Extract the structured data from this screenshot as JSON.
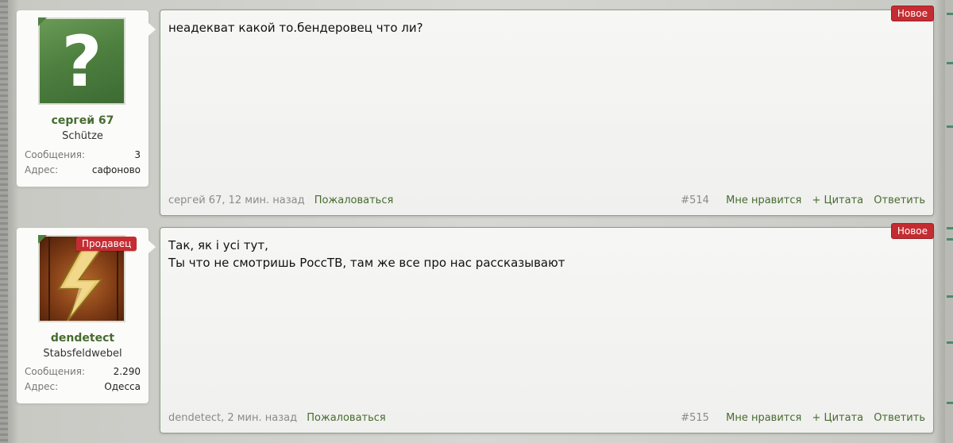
{
  "posts": [
    {
      "user": {
        "name": "сергей 67",
        "title": "Schütze",
        "posts_label": "Сообщения:",
        "posts_value": "3",
        "address_label": "Адрес:",
        "address_value": "сафоново",
        "avatar_glyph": "?"
      },
      "badge": "Новое",
      "lines": [
        "неадекват какой то.бендеровец что ли?"
      ],
      "author_time": "сергей 67, 12 мин. назад",
      "report": "Пожаловаться",
      "number": "#514",
      "like": "Мне нравится",
      "quote": "+ Цитата",
      "reply": "Ответить"
    },
    {
      "user": {
        "name": "dendetect",
        "title": "Stabsfeldwebel",
        "seller_badge": "Продавец",
        "posts_label": "Сообщения:",
        "posts_value": "2.290",
        "address_label": "Адрес:",
        "address_value": "Одесса"
      },
      "badge": "Новое",
      "lines": [
        "Так, як і усі тут,",
        "Ты что не смотришь РоссТВ, там же все про нас рассказывают"
      ],
      "author_time": "dendetect, 2 мин. назад",
      "report": "Пожаловаться",
      "number": "#515",
      "like": "Мне нравится",
      "quote": "+ Цитата",
      "reply": "Ответить"
    }
  ],
  "colors": {
    "accent": "#476b2f",
    "badge": "#c42c32",
    "border": "#8f9e89"
  },
  "icons": {
    "avatar1": "question-mark-icon",
    "avatar2": "lightning-bolt-icon"
  }
}
